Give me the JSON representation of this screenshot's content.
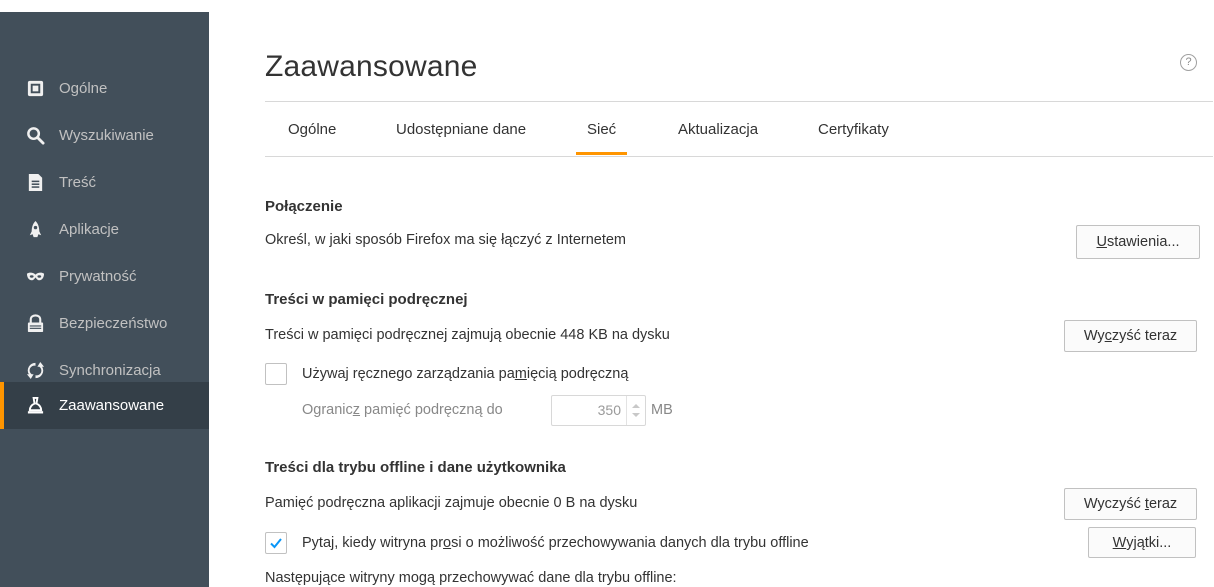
{
  "sidebar": {
    "items": [
      {
        "label": "Ogólne",
        "icon": "general-icon"
      },
      {
        "label": "Wyszukiwanie",
        "icon": "search-icon"
      },
      {
        "label": "Treść",
        "icon": "content-icon"
      },
      {
        "label": "Aplikacje",
        "icon": "applications-icon"
      },
      {
        "label": "Prywatność",
        "icon": "privacy-mask-icon"
      },
      {
        "label": "Bezpieczeństwo",
        "icon": "security-lock-icon"
      },
      {
        "label": "Synchronizacja",
        "icon": "sync-icon"
      },
      {
        "label": "Zaawansowane",
        "icon": "advanced-wizard-icon",
        "active": true
      }
    ]
  },
  "page": {
    "title": "Zaawansowane",
    "help": "?"
  },
  "tabs": [
    {
      "label": "Ogólne"
    },
    {
      "label": "Udostępniane dane"
    },
    {
      "label": "Sieć",
      "selected": true
    },
    {
      "label": "Aktualizacja"
    },
    {
      "label": "Certyfikaty"
    }
  ],
  "connection": {
    "title": "Połączenie",
    "description": "Określ, w jaki sposób Firefox ma się łączyć z Internetem",
    "settings_button": {
      "accesskey": "U",
      "rest": "stawienia..."
    }
  },
  "cache": {
    "title": "Treści w pamięci podręcznej",
    "description": "Treści w pamięci podręcznej zajmują obecnie 448 KB na dysku",
    "clear_button": {
      "before": "Wy",
      "accesskey": "c",
      "after": "zyść teraz"
    },
    "manual_checkbox": {
      "before": "Używaj ręcznego zarządzania pa",
      "accesskey": "m",
      "after": "ięcią podręczną",
      "checked": false
    },
    "limit_label": {
      "before": "Ogranic",
      "accesskey": "z",
      "after": " pamięć podręczną do"
    },
    "limit_value": "350",
    "limit_unit": "MB"
  },
  "offline": {
    "title": "Treści dla trybu offline i dane użytkownika",
    "description": "Pamięć podręczna aplikacji zajmuje obecnie 0 B na dysku",
    "clear_button": {
      "before": "Wyczyść ",
      "accesskey": "t",
      "after": "eraz"
    },
    "ask_checkbox": {
      "before": "Pytaj, kiedy witryna pr",
      "accesskey": "o",
      "after": "si o możliwość przechowywania danych dla trybu offline",
      "checked": true
    },
    "exceptions_button": {
      "accesskey": "W",
      "rest": "yjątki..."
    },
    "sites_label": "Następujące witryny mogą przechowywać dane dla trybu offline:"
  },
  "colors": {
    "sidebar_bg": "#424f5a",
    "sidebar_active_bg": "#343f48",
    "accent": "#ff9500",
    "check": "#0996f8"
  }
}
